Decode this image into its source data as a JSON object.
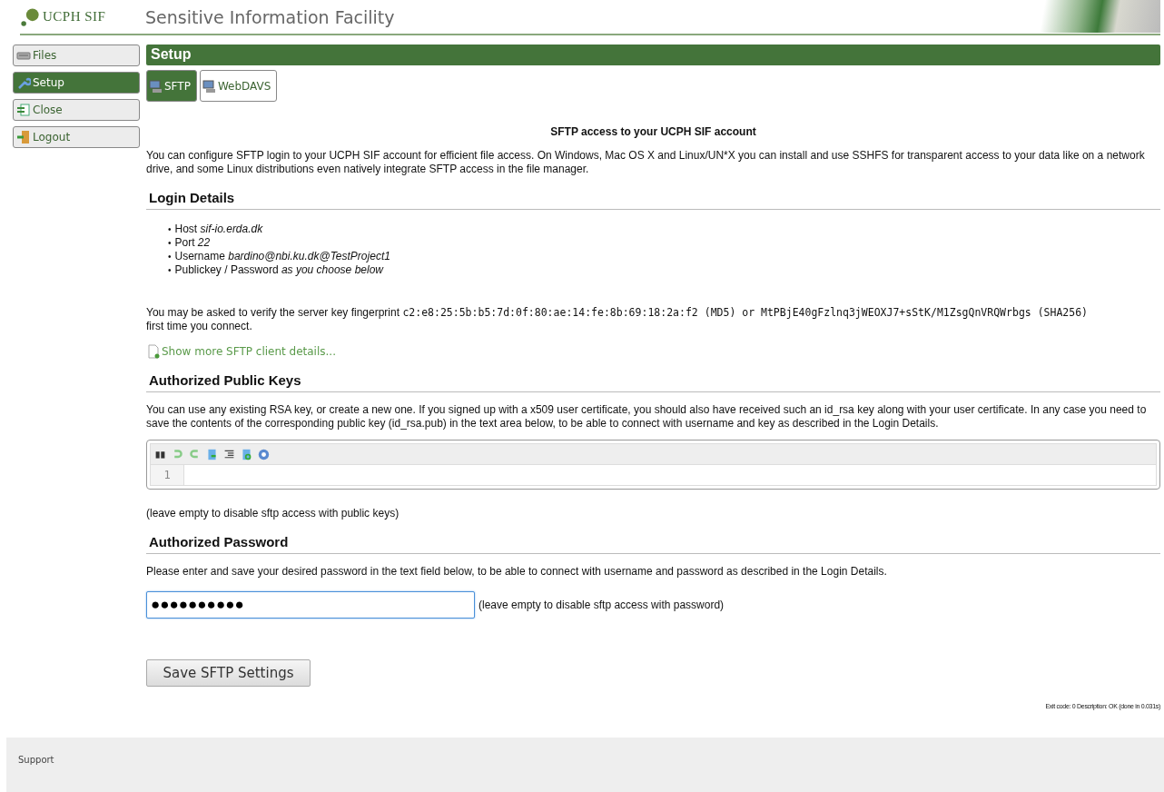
{
  "header": {
    "logo_text": "UCPH SIF",
    "title": "Sensitive Information Facility"
  },
  "sidebar": {
    "items": [
      {
        "label": "Files",
        "selected": false
      },
      {
        "label": "Setup",
        "selected": true
      },
      {
        "label": "Close",
        "selected": false
      },
      {
        "label": "Logout",
        "selected": false
      }
    ]
  },
  "page_title": "Setup",
  "tabs": [
    {
      "label": "SFTP",
      "selected": true
    },
    {
      "label": "WebDAVS",
      "selected": false
    }
  ],
  "heading": "SFTP access to your UCPH SIF account",
  "intro": "You can configure SFTP login to your UCPH SIF account for efficient file access. On Windows, Mac OS X and Linux/UN*X you can install and use SSHFS for transparent access to your data like on a network drive, and some Linux distributions even natively integrate SFTP access in the file manager.",
  "login_details": {
    "title": "Login Details",
    "items": [
      {
        "bullet": "•",
        "text": "Host *sif-io.erda.dk*"
      },
      {
        "bullet": "•",
        "text": "Port *22*"
      },
      {
        "bullet": "•",
        "text": "Username *bardino@nbi.ku.dk@TestProject1*"
      },
      {
        "bullet": "•",
        "text": "Publickey / Password *as you choose below*"
      }
    ],
    "fingerprint_before": "You may be asked to verify the server key fingerprint",
    "fingerprint_code": "c2:e8:25:5b:b5:7d:0f:80:ae:14:fe:8b:69:18:2a:f2 (MD5) or MtPBjE40gFzlnq3jWEOXJ7+sStK/M1ZsgQnVRQWrbgs (SHA256)",
    "fingerprint_after": "first time you connect.",
    "more_link": "Show more SFTP client details..."
  },
  "public_keys": {
    "title": "Authorized Public Keys",
    "text": "You can use any existing RSA key, or create a new one. If you signed up with a x509 user certificate, you should also have received such an id_rsa key along with your user certificate. In any case you need to save the contents of the corresponding public key (id_rsa.pub) in the text area below, to be able to connect with username and key as described in the Login Details.",
    "line_number": "1",
    "note": "(leave empty to disable sftp access with public keys)"
  },
  "password": {
    "title": "Authorized Password",
    "text": "Please enter and save your desired password in the text field below, to be able to connect with username and password as described in the Login Details.",
    "value": "●●●●●●●●●●",
    "note": "(leave empty to disable sftp access with password)"
  },
  "save_button": "Save SFTP Settings",
  "status": "Exit code: 0 Description: OK (done in 0.031s)",
  "footer": {
    "support": "Support"
  }
}
